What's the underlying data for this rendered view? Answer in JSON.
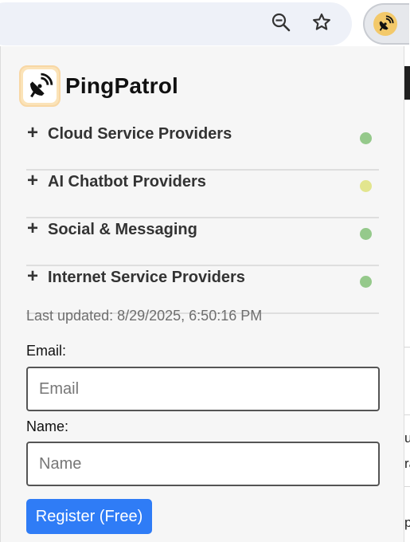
{
  "browser": {
    "zoom_icon": "zoom-out-icon",
    "bookmark_icon": "star-icon",
    "extension_icon": "satellite-dish-icon"
  },
  "background_page": {
    "fragments": [
      "ur",
      "ra",
      "p"
    ]
  },
  "popup": {
    "app_name": "PingPatrol",
    "logo_icon": "satellite-dish-icon",
    "groups": [
      {
        "label": "Cloud Service Providers",
        "expand_symbol": "+",
        "status_color": "#95c98b"
      },
      {
        "label": "AI Chatbot Providers",
        "expand_symbol": "+",
        "status_color": "#e2e58e"
      },
      {
        "label": "Social & Messaging",
        "expand_symbol": "+",
        "status_color": "#95c98b"
      },
      {
        "label": "Internet Service Providers",
        "expand_symbol": "+",
        "status_color": "#95c98b"
      }
    ],
    "last_updated": "Last updated: 8/29/2025, 6:50:16 PM",
    "email_label": "Email:",
    "email_placeholder": "Email",
    "email_value": "",
    "name_label": "Name:",
    "name_placeholder": "Name",
    "name_value": "",
    "register_label": "Register (Free)"
  },
  "colors": {
    "accent": "#2f7cf6",
    "status_green": "#95c98b",
    "status_yellow": "#e2e58e"
  }
}
